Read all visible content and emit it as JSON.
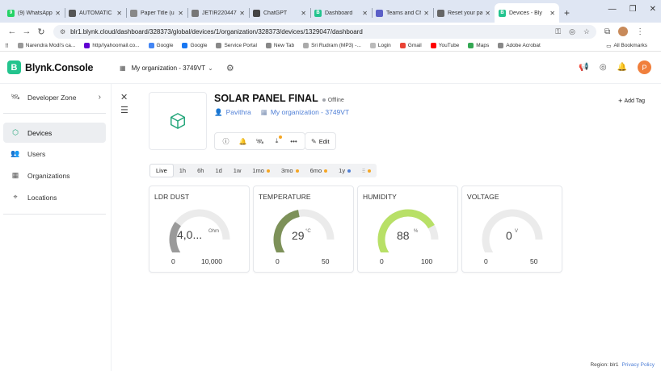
{
  "browser": {
    "tabs": [
      {
        "title": "(9) WhatsApp",
        "color": "#25d366",
        "glyph": "9"
      },
      {
        "title": "AUTOMATIC",
        "color": "#555",
        "glyph": ""
      },
      {
        "title": "Paper Title (u",
        "color": "#888",
        "glyph": ""
      },
      {
        "title": "JETIR2204470",
        "color": "#777",
        "glyph": ""
      },
      {
        "title": "ChatGPT",
        "color": "#444",
        "glyph": ""
      },
      {
        "title": "Dashboard",
        "color": "#23c48e",
        "glyph": "B"
      },
      {
        "title": "Teams and Ch",
        "color": "#5b5fc7",
        "glyph": ""
      },
      {
        "title": "Reset your pa",
        "color": "#666",
        "glyph": ""
      },
      {
        "title": "Devices - Bly",
        "color": "#23c48e",
        "glyph": "B"
      }
    ],
    "url": "blr1.blynk.cloud/dashboard/328373/global/devices/1/organization/328373/devices/1329047/dashboard",
    "bookmarks": [
      {
        "label": "Narendra Modi's ca...",
        "color": "#999"
      },
      {
        "label": "http//yahoomail.co...",
        "color": "#6001d2"
      },
      {
        "label": "Google",
        "color": "#4285f4"
      },
      {
        "label": "Google",
        "color": "#1877f2"
      },
      {
        "label": "Service Portal",
        "color": "#888"
      },
      {
        "label": "New Tab",
        "color": "#888"
      },
      {
        "label": "Sri Rudram (MP3) -...",
        "color": "#aaa"
      },
      {
        "label": "Login",
        "color": "#bbb"
      },
      {
        "label": "Gmail",
        "color": "#ea4335"
      },
      {
        "label": "YouTube",
        "color": "#ff0000"
      },
      {
        "label": "Maps",
        "color": "#34a853"
      },
      {
        "label": "Adobe Acrobat",
        "color": "#888"
      }
    ],
    "all_bookmarks": "All Bookmarks"
  },
  "app": {
    "brand": "Blynk.Console",
    "brand_letter": "B",
    "organization": "My organization - 3749VT",
    "avatar_letter": "P",
    "accent": "#23c48e"
  },
  "sidebar": {
    "items": [
      {
        "label": "Developer Zone"
      },
      {
        "label": "Devices"
      },
      {
        "label": "Users"
      },
      {
        "label": "Organizations"
      },
      {
        "label": "Locations"
      }
    ]
  },
  "device": {
    "name": "SOLAR PANEL FINAL",
    "status": "Offline",
    "owner": "Pavithra",
    "organization": "My organization - 3749VT",
    "edit_label": "Edit",
    "add_tag_label": "Add Tag"
  },
  "time_ranges": [
    {
      "label": "Live",
      "active": true,
      "dot": ""
    },
    {
      "label": "1h",
      "dot": ""
    },
    {
      "label": "6h",
      "dot": ""
    },
    {
      "label": "1d",
      "dot": ""
    },
    {
      "label": "1w",
      "dot": ""
    },
    {
      "label": "1mo",
      "dot": "#f5a623"
    },
    {
      "label": "3mo",
      "dot": "#f5a623"
    },
    {
      "label": "6mo",
      "dot": "#f5a623"
    },
    {
      "label": "1y",
      "dot": "#4f7fd6"
    }
  ],
  "widgets": [
    {
      "title": "LDR DUST",
      "value": "4,0...",
      "unit": "Ohm",
      "min": "0",
      "max": "10,000",
      "fraction": 0.4,
      "color": "#9a9a9a"
    },
    {
      "title": "TEMPERATURE",
      "value": "29",
      "unit": "°C",
      "min": "0",
      "max": "50",
      "fraction": 0.58,
      "color": "#7d9159"
    },
    {
      "title": "HUMIDITY",
      "value": "88",
      "unit": "%",
      "min": "0",
      "max": "100",
      "fraction": 0.88,
      "color": "#b8e067"
    },
    {
      "title": "VOLTAGE",
      "value": "0",
      "unit": "V",
      "min": "0",
      "max": "50",
      "fraction": 0,
      "color": "#9a9a9a"
    }
  ],
  "footer": {
    "region": "Region: blr1",
    "privacy": "Privacy Policy"
  }
}
